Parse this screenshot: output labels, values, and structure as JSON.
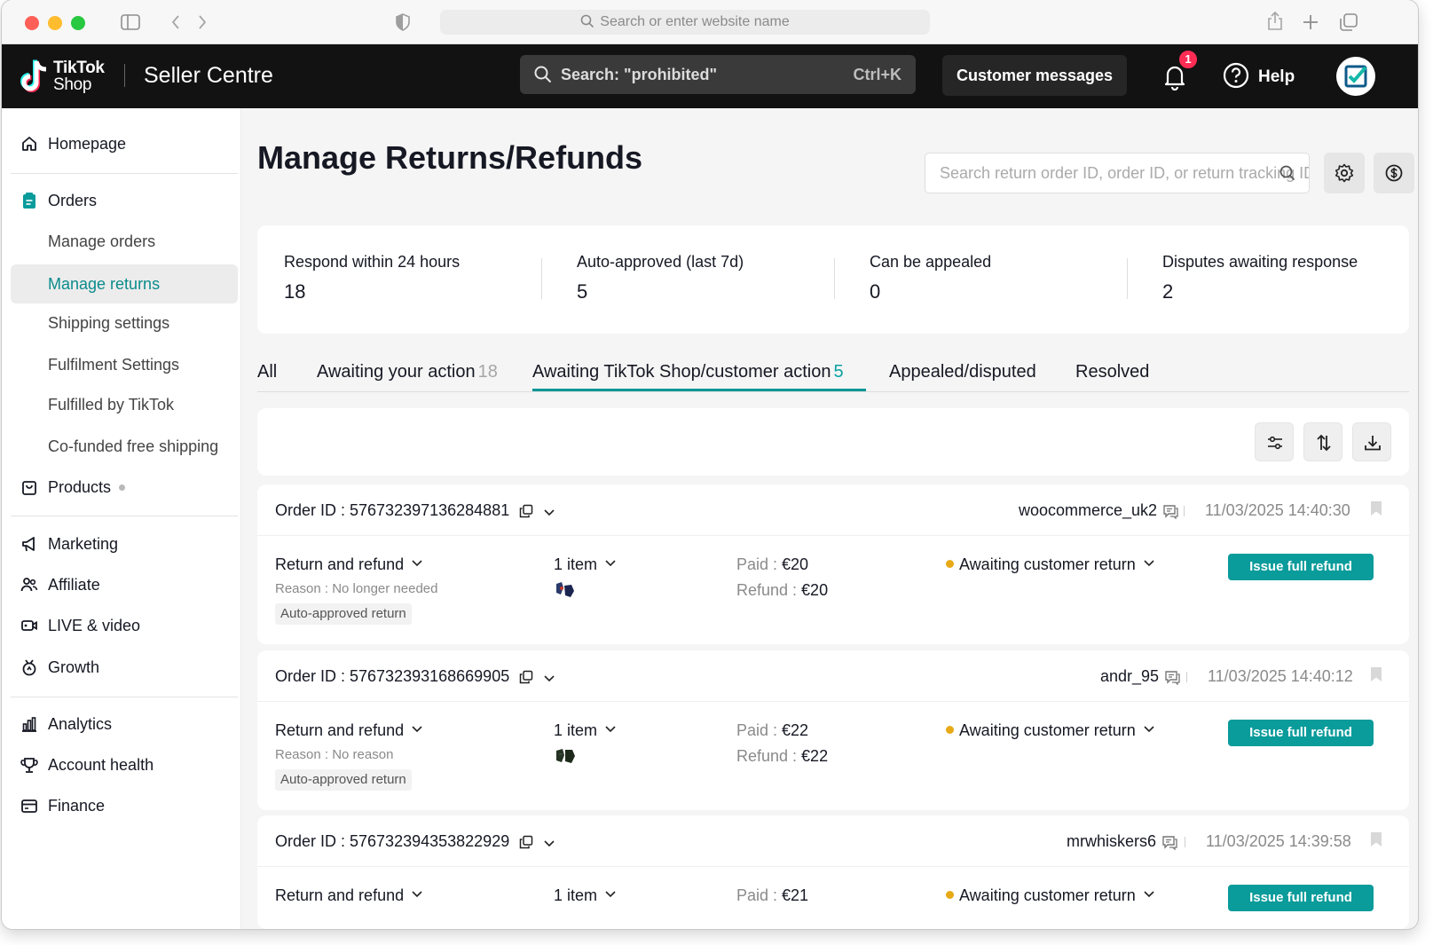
{
  "browser": {
    "url_placeholder": "Search or enter website name"
  },
  "topnav": {
    "logo_line1": "TikTok",
    "logo_line2": "Shop",
    "app_title": "Seller Centre",
    "search_text": "Search: \"prohibited\"",
    "search_shortcut": "Ctrl+K",
    "customer_messages": "Customer messages",
    "notification_count": "1",
    "help": "Help"
  },
  "sidebar": {
    "homepage": "Homepage",
    "orders": "Orders",
    "orders_sub": [
      "Manage orders",
      "Manage returns",
      "Shipping settings",
      "Fulfilment Settings",
      "Fulfilled by TikTok",
      "Co-funded free shipping"
    ],
    "products": "Products",
    "marketing": "Marketing",
    "affiliate": "Affiliate",
    "live_video": "LIVE & video",
    "growth": "Growth",
    "analytics": "Analytics",
    "account_health": "Account health",
    "finance": "Finance"
  },
  "main": {
    "title": "Manage Returns/Refunds",
    "search_placeholder": "Search return order ID, order ID, or return tracking ID",
    "stats": [
      {
        "label": "Respond within 24 hours",
        "value": "18"
      },
      {
        "label": "Auto-approved (last 7d)",
        "value": "5"
      },
      {
        "label": "Can be appealed",
        "value": "0"
      },
      {
        "label": "Disputes awaiting response",
        "value": "2"
      }
    ],
    "tabs": [
      {
        "label": "All",
        "count": ""
      },
      {
        "label": "Awaiting your action",
        "count": "18"
      },
      {
        "label": "Awaiting TikTok Shop/customer action",
        "count": "5"
      },
      {
        "label": "Appealed/disputed",
        "count": ""
      },
      {
        "label": "Resolved",
        "count": ""
      }
    ],
    "active_tab": "Awaiting TikTok Shop/customer action"
  },
  "orders": [
    {
      "order_id_label": "Order ID : ",
      "order_id": "576732397136284881",
      "username": "woocommerce_uk2",
      "datetime": "11/03/2025 14:40:30",
      "type": "Return and refund",
      "reason": "Reason : No longer needed",
      "tag": "Auto-approved return",
      "items": "1 item",
      "paid_label": "Paid : ",
      "paid": "€20",
      "refund_label": "Refund : ",
      "refund": "€20",
      "status": "Awaiting customer return",
      "action": "Issue full refund"
    },
    {
      "order_id_label": "Order ID : ",
      "order_id": "576732393168669905",
      "username": "andr_95",
      "datetime": "11/03/2025 14:40:12",
      "type": "Return and refund",
      "reason": "Reason : No reason",
      "tag": "Auto-approved return",
      "items": "1 item",
      "paid_label": "Paid : ",
      "paid": "€22",
      "refund_label": "Refund : ",
      "refund": "€22",
      "status": "Awaiting customer return",
      "action": "Issue full refund"
    },
    {
      "order_id_label": "Order ID : ",
      "order_id": "576732394353822929",
      "username": "mrwhiskers6",
      "datetime": "11/03/2025 14:39:58",
      "type": "Return and refund",
      "items": "1 item",
      "paid_label": "Paid : ",
      "paid": "€21",
      "status": "Awaiting customer return",
      "action": "Issue full refund"
    }
  ],
  "colors": {
    "accent": "#0a9b9b",
    "topbar": "#121212",
    "status_dot": "#e8a916",
    "badge": "#fe2c55"
  }
}
